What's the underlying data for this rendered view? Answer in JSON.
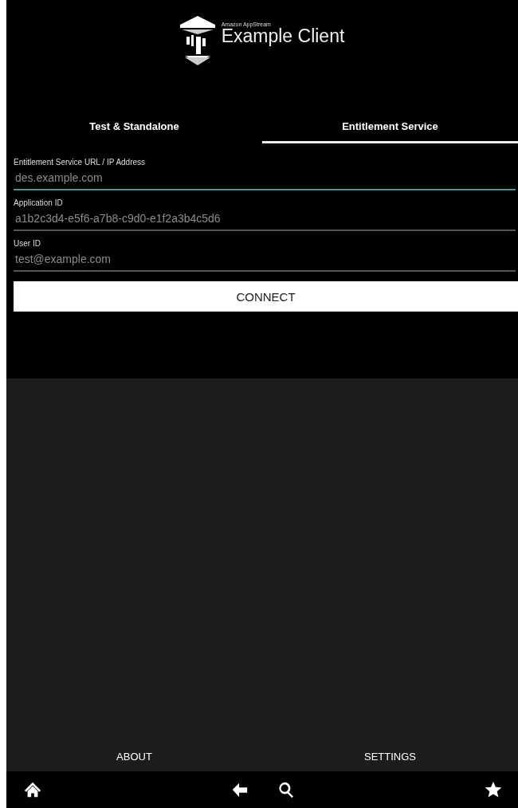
{
  "header": {
    "brand": "Amazon AppStream",
    "title": "Example Client"
  },
  "tabs": [
    {
      "label": "Test & Standalone",
      "selected": false
    },
    {
      "label": "Entitlement Service",
      "selected": true
    }
  ],
  "fields": [
    {
      "label": "Entitlement Service URL / IP Address",
      "placeholder": "des.example.com",
      "focused": true
    },
    {
      "label": "Application ID",
      "placeholder": "a1b2c3d4-e5f6-a7b8-c9d0-e1f2a3b4c5d6",
      "focused": false
    },
    {
      "label": "User ID",
      "placeholder": "test@example.com",
      "focused": false
    }
  ],
  "connect_button": "CONNECT",
  "footer_buttons": [
    "ABOUT",
    "SETTINGS"
  ],
  "nav_bar": [
    {
      "kind": "home"
    },
    {
      "kind": "back"
    },
    {
      "kind": "search"
    },
    {
      "kind": "star"
    }
  ]
}
